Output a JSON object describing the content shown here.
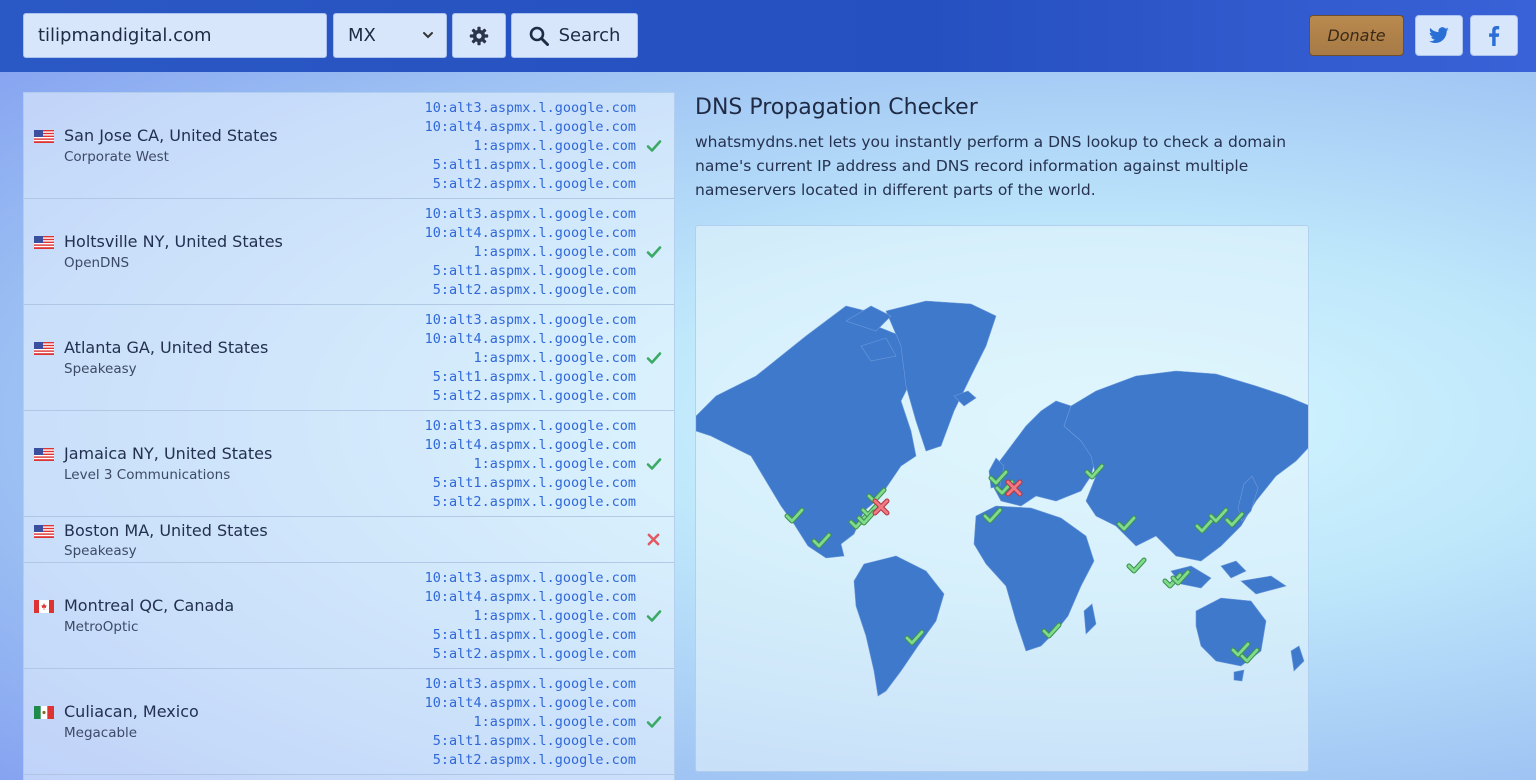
{
  "search": {
    "domain": "tilipmandigital.com",
    "record_type": "MX",
    "button_label": "Search"
  },
  "header": {
    "donate_label": "Donate"
  },
  "page": {
    "title": "DNS Propagation Checker",
    "description": "whatsmydns.net lets you instantly perform a DNS lookup to check a domain name's current IP address and DNS record information against multiple nameservers located in different parts of the world."
  },
  "results": [
    {
      "location": "San Jose CA, United States",
      "provider": "Corporate West",
      "flag": "us",
      "status": "ok",
      "records": [
        "10:alt3.aspmx.l.google.com",
        "10:alt4.aspmx.l.google.com",
        "1:aspmx.l.google.com",
        "5:alt1.aspmx.l.google.com",
        "5:alt2.aspmx.l.google.com"
      ]
    },
    {
      "location": "Holtsville NY, United States",
      "provider": "OpenDNS",
      "flag": "us",
      "status": "ok",
      "records": [
        "10:alt3.aspmx.l.google.com",
        "10:alt4.aspmx.l.google.com",
        "1:aspmx.l.google.com",
        "5:alt1.aspmx.l.google.com",
        "5:alt2.aspmx.l.google.com"
      ]
    },
    {
      "location": "Atlanta GA, United States",
      "provider": "Speakeasy",
      "flag": "us",
      "status": "ok",
      "records": [
        "10:alt3.aspmx.l.google.com",
        "10:alt4.aspmx.l.google.com",
        "1:aspmx.l.google.com",
        "5:alt1.aspmx.l.google.com",
        "5:alt2.aspmx.l.google.com"
      ]
    },
    {
      "location": "Jamaica NY, United States",
      "provider": "Level 3 Communications",
      "flag": "us",
      "status": "ok",
      "records": [
        "10:alt3.aspmx.l.google.com",
        "10:alt4.aspmx.l.google.com",
        "1:aspmx.l.google.com",
        "5:alt1.aspmx.l.google.com",
        "5:alt2.aspmx.l.google.com"
      ]
    },
    {
      "location": "Boston MA, United States",
      "provider": "Speakeasy",
      "flag": "us",
      "status": "fail",
      "records": []
    },
    {
      "location": "Montreal QC, Canada",
      "provider": "MetroOptic",
      "flag": "ca",
      "status": "ok",
      "records": [
        "10:alt3.aspmx.l.google.com",
        "10:alt4.aspmx.l.google.com",
        "1:aspmx.l.google.com",
        "5:alt1.aspmx.l.google.com",
        "5:alt2.aspmx.l.google.com"
      ]
    },
    {
      "location": "Culiacan, Mexico",
      "provider": "Megacable",
      "flag": "mx",
      "status": "ok",
      "records": [
        "10:alt3.aspmx.l.google.com",
        "10:alt4.aspmx.l.google.com",
        "1:aspmx.l.google.com",
        "5:alt1.aspmx.l.google.com",
        "5:alt2.aspmx.l.google.com"
      ]
    }
  ],
  "map": {
    "markers": [
      {
        "name": "marker-san-jose",
        "status": "ok"
      },
      {
        "name": "marker-culiacan",
        "status": "ok"
      },
      {
        "name": "marker-atlanta",
        "status": "ok"
      },
      {
        "name": "marker-montreal",
        "status": "ok"
      },
      {
        "name": "marker-holtsville",
        "status": "ok"
      },
      {
        "name": "marker-jamaica",
        "status": "ok"
      },
      {
        "name": "marker-boston",
        "status": "fail"
      },
      {
        "name": "marker-brazil",
        "status": "ok"
      },
      {
        "name": "marker-uk",
        "status": "ok"
      },
      {
        "name": "marker-netherlands",
        "status": "ok"
      },
      {
        "name": "marker-germany",
        "status": "fail"
      },
      {
        "name": "marker-spain",
        "status": "ok"
      },
      {
        "name": "marker-russia",
        "status": "ok"
      },
      {
        "name": "marker-india",
        "status": "ok"
      },
      {
        "name": "marker-sri-lanka",
        "status": "ok"
      },
      {
        "name": "marker-malaysia",
        "status": "ok"
      },
      {
        "name": "marker-singapore",
        "status": "ok"
      },
      {
        "name": "marker-china",
        "status": "ok"
      },
      {
        "name": "marker-korea",
        "status": "ok"
      },
      {
        "name": "marker-japan",
        "status": "ok"
      },
      {
        "name": "marker-south-africa",
        "status": "ok"
      },
      {
        "name": "marker-sydney",
        "status": "ok"
      },
      {
        "name": "marker-melbourne",
        "status": "ok"
      }
    ]
  },
  "colors": {
    "header_bg": "#2550c0",
    "record_text": "#3068d8",
    "check": "#3caa66",
    "fail": "#e05a63",
    "land": "#3f79cc"
  }
}
